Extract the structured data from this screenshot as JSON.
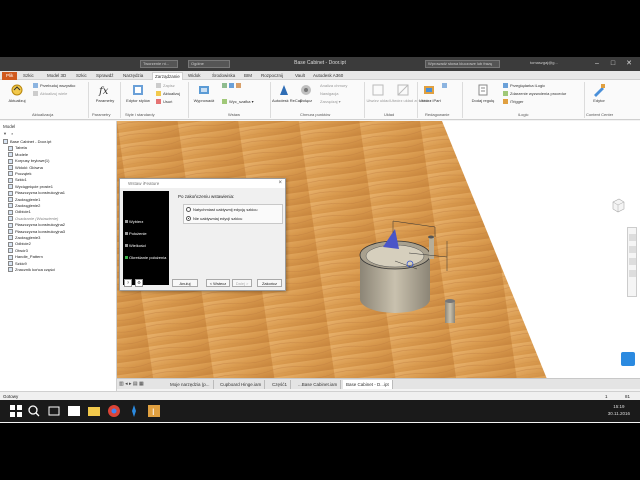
{
  "titlebar": {
    "title": "Base Cabinet - Door.ipt",
    "quick_box_1": "Tworzenie nt...",
    "quick_box_2": "Ogólne",
    "search_placeholder": "Wprowadź słowa kluczowe lub frazę",
    "user": "tomaszgaj@g...",
    "minimize": "–",
    "maximize": "□",
    "close": "✕"
  },
  "tabs": [
    "Plik",
    "Szkic",
    "Model 3D",
    "Szkic",
    "Sprawdź",
    "Narzędzia",
    "Zarządzanie",
    "Widok",
    "Środowiska",
    "BIM",
    "Rozpocznij",
    "Vault",
    "Autodesk A360"
  ],
  "ribbon": {
    "aktualizuj": "Aktualizuj",
    "przebuduj": "Przebuduj wszystko",
    "aktualizuj_wiele": "Aktualizuj wiele",
    "parametry": "Parametry",
    "edytor_stylow": "Edytor stylów",
    "zapisz": "Zapisz",
    "aktualizuj_s": "Aktualizuj",
    "usun": "Usuń",
    "wypronowanie": "Wyprowadź",
    "wyc_szafka": "Wyc_szafka",
    "autodesk_recap": "Autodesk ReCap",
    "dolacz": "Dołącz",
    "analiza_chmury": "Analiza chmury",
    "nawigacja": "Nawigacja",
    "zarzadzaj": "Zarządzaj",
    "utworz_uklad": "Utwórz układ",
    "utworz_uklad_dwg": "Utwórz układ ze szkicu",
    "utworz_ipart": "Utwórz iPart",
    "dodaj_regule": "Dodaj regułę",
    "przegladarka": "Przeglądarka iLogic",
    "zdarzenie": "Zdarzenie wyzwolenia procedur",
    "itrigger": "iTrigger",
    "edytor": "Edytor",
    "groups": {
      "aktualizacja": "Aktualizacja",
      "parametry": "Parametry",
      "style": "Style i standardy",
      "wstaw": "Wstaw",
      "chmura": "Chmura punktów",
      "uklad": "Układ",
      "redagowanie": "Redagowanie",
      "ilogic": "iLogic",
      "content": "Content Center"
    }
  },
  "browser": {
    "header": "Model",
    "rows": [
      {
        "label": "Base Cabinet - Door.ipt",
        "dim": false
      },
      {
        "label": "Tabela",
        "dim": false
      },
      {
        "label": "Modele",
        "dim": false
      },
      {
        "label": "Korpusy brylowe(1)",
        "dim": false
      },
      {
        "label": "Widoki: Główna",
        "dim": false
      },
      {
        "label": "Początek",
        "dim": false
      },
      {
        "label": "Szkic1",
        "dim": false
      },
      {
        "label": "Wyciągnięcie proste1",
        "dim": false
      },
      {
        "label": "Płaszczyzna konstrukcyjna1",
        "dim": false
      },
      {
        "label": "Zaokrąglenie1",
        "dim": false
      },
      {
        "label": "Zaokrąglenie2",
        "dim": false
      },
      {
        "label": "Odbicie1",
        "dim": false
      },
      {
        "label": "Osadzanie (Wstawienie)",
        "dim": true
      },
      {
        "label": "Płaszczyzna konstrukcyjna2",
        "dim": false
      },
      {
        "label": "Płaszczyzna konstrukcyjna3",
        "dim": false
      },
      {
        "label": "Zaokrąglenie3",
        "dim": false
      },
      {
        "label": "Odbicie2",
        "dim": false
      },
      {
        "label": "Otwór3",
        "dim": false
      },
      {
        "label": "Handle_Pattern",
        "dim": false
      },
      {
        "label": "Szkic9",
        "dim": false
      },
      {
        "label": "Znacznik końca części",
        "dim": false
      }
    ]
  },
  "dialog": {
    "title": "Wstaw iFeature",
    "steps": [
      "Wybierz",
      "Położenie",
      "Wielkości",
      "Określanie położenia"
    ],
    "question": "Po zakończeniu wstawienia:",
    "option1": "Natychmiast uaktywnij edycję szkicu",
    "option2": "Nie uaktywniaj edycji szkicu",
    "btn_anuluj": "Anuluj",
    "btn_wstecz": "< Wstecz",
    "btn_dalej": "Dalej >",
    "btn_zakoncz": "Zakończ"
  },
  "doctabs": [
    "Moje narzędzia (p...",
    "Cupboard Hinge.iam",
    "Część1",
    "...Base Cabinet.iam",
    "Base Cabinet - D...ipt"
  ],
  "status": {
    "left": "Gotowy",
    "right_a": "1",
    "right_b": "81"
  },
  "clock": {
    "time": "15:19",
    "date": "30.11.2016"
  },
  "colors": {
    "file_tab": "#d15a1e",
    "wood": "#d99a4e",
    "step_current": "#3cb44b"
  }
}
